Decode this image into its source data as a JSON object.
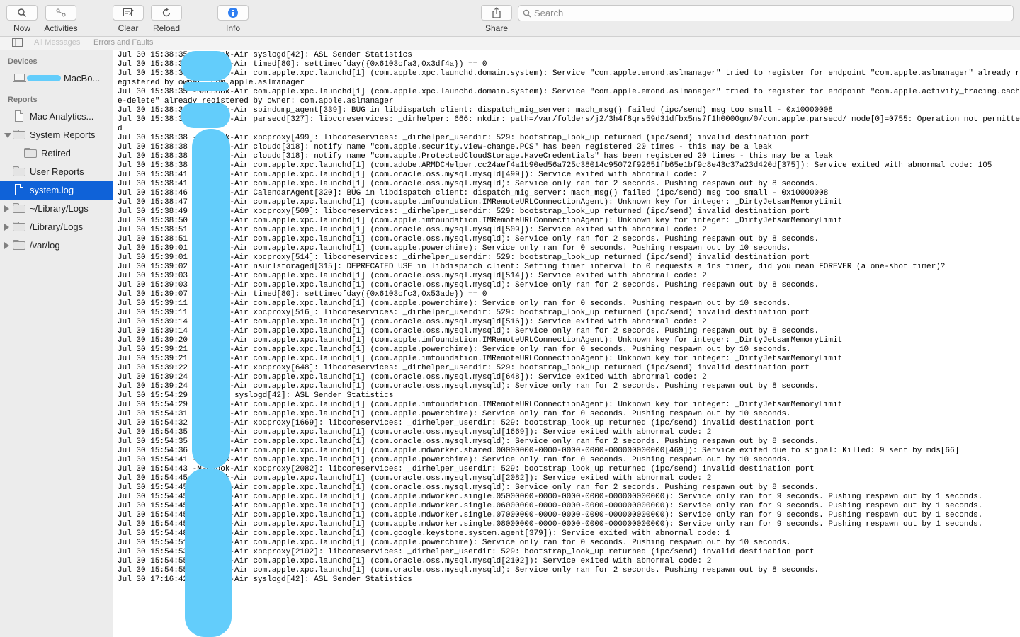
{
  "toolbar": {
    "now": "Now",
    "activities": "Activities",
    "clear": "Clear",
    "reload": "Reload",
    "info": "Info",
    "share": "Share",
    "search_placeholder": "Search"
  },
  "filters": {
    "all_messages": "All Messages",
    "errors_faults": "Errors and Faults"
  },
  "sidebar": {
    "devices_header": "Devices",
    "device_name": "MacBo...",
    "reports_header": "Reports",
    "items": [
      {
        "label": "Mac Analytics...",
        "kind": "doc"
      },
      {
        "label": "System Reports",
        "kind": "folder",
        "disclosure": "down"
      },
      {
        "label": "Retired",
        "kind": "folder"
      },
      {
        "label": "User Reports",
        "kind": "folder"
      },
      {
        "label": "system.log",
        "kind": "doc",
        "selected": true
      },
      {
        "label": "~/Library/Logs",
        "kind": "folder",
        "disclosure": "right"
      },
      {
        "label": "/Library/Logs",
        "kind": "folder",
        "disclosure": "right"
      },
      {
        "label": "/var/log",
        "kind": "folder",
        "disclosure": "right"
      }
    ]
  },
  "log_lines": [
    "Jul 30 15:38:35 -MacBook-Air syslogd[42]: ASL Sender Statistics",
    "Jul 30 15:38:35 -MacBook-Air timed[80]: settimeofday({0x6103cfa3,0x3df4a}) == 0",
    "Jul 30 15:38:35 -MacBook-Air com.apple.xpc.launchd[1] (com.apple.xpc.launchd.domain.system): Service \"com.apple.emond.aslmanager\" tried to register for endpoint \"com.apple.aslmanager\" already registered by owner: com.apple.aslmanager",
    "Jul 30 15:38:35 -MacBook-Air com.apple.xpc.launchd[1] (com.apple.xpc.launchd.domain.system): Service \"com.apple.emond.aslmanager\" tried to register for endpoint \"com.apple.activity_tracing.cache-delete\" already registered by owner: com.apple.aslmanager",
    "Jul 30 15:38:36 -MacBook-Air spindump_agent[339]: BUG in libdispatch client: dispatch_mig_server: mach_msg() failed (ipc/send) msg too small - 0x10000008",
    "Jul 30 15:38:37 -MacBook-Air parsecd[327]: libcoreservices: _dirhelper: 666: mkdir: path=/var/folders/j2/3h4f8qrs59d31dfbx5ns7f1h0000gn/0/com.apple.parsecd/ mode[0]=0755: Operation not permitted",
    "Jul 30 15:38:38 -MacBook-Air xpcproxy[499]: libcoreservices: _dirhelper_userdir: 529: bootstrap_look_up returned (ipc/send) invalid destination port",
    "Jul 30 15:38:38 -MacBook-Air cloudd[318]: notify name \"com.apple.security.view-change.PCS\" has been registered 20 times - this may be a leak",
    "Jul 30 15:38:38 -MacBook-Air cloudd[318]: notify name \"com.apple.ProtectedCloudStorage.HaveCredentials\" has been registered 20 times - this may be a leak",
    "Jul 30 15:38:38 -MacBook-Air com.apple.xpc.launchd[1] (com.adobe.ARMDCHelper.cc24aef4a1b90ed56a725c38014c95072f92651fb65e1bf9c8e43c37a23d420d[375]): Service exited with abnormal code: 105",
    "Jul 30 15:38:41 -MacBook-Air com.apple.xpc.launchd[1] (com.oracle.oss.mysql.mysqld[499]): Service exited with abnormal code: 2",
    "Jul 30 15:38:41 -MacBook-Air com.apple.xpc.launchd[1] (com.oracle.oss.mysql.mysqld): Service only ran for 2 seconds. Pushing respawn out by 8 seconds.",
    "Jul 30 15:38:46 -MacBook-Air CalendarAgent[320]: BUG in libdispatch client: dispatch_mig_server: mach_msg() failed (ipc/send) msg too small - 0x10000008",
    "Jul 30 15:38:47 -MacBook-Air com.apple.xpc.launchd[1] (com.apple.imfoundation.IMRemoteURLConnectionAgent): Unknown key for integer: _DirtyJetsamMemoryLimit",
    "Jul 30 15:38:49 -MacBook-Air xpcproxy[509]: libcoreservices: _dirhelper_userdir: 529: bootstrap_look_up returned (ipc/send) invalid destination port",
    "Jul 30 15:38:50 -MacBook-Air com.apple.xpc.launchd[1] (com.apple.imfoundation.IMRemoteURLConnectionAgent): Unknown key for integer: _DirtyJetsamMemoryLimit",
    "Jul 30 15:38:51 -MacBook-Air com.apple.xpc.launchd[1] (com.oracle.oss.mysql.mysqld[509]): Service exited with abnormal code: 2",
    "Jul 30 15:38:51 -MacBook-Air com.apple.xpc.launchd[1] (com.oracle.oss.mysql.mysqld): Service only ran for 2 seconds. Pushing respawn out by 8 seconds.",
    "Jul 30 15:39:01 -MacBook-Air com.apple.xpc.launchd[1] (com.apple.powerchime): Service only ran for 0 seconds. Pushing respawn out by 10 seconds.",
    "Jul 30 15:39:01 -MacBook-Air xpcproxy[514]: libcoreservices: _dirhelper_userdir: 529: bootstrap_look_up returned (ipc/send) invalid destination port",
    "Jul 30 15:39:02 -MacBook-Air nsurlstoraged[315]: DEPRECATED USE in libdispatch client: Setting timer interval to 0 requests a 1ns timer, did you mean FOREVER (a one-shot timer)?",
    "Jul 30 15:39:03 -MacBook-Air com.apple.xpc.launchd[1] (com.oracle.oss.mysql.mysqld[514]): Service exited with abnormal code: 2",
    "Jul 30 15:39:03 -MacBook-Air com.apple.xpc.launchd[1] (com.oracle.oss.mysql.mysqld): Service only ran for 2 seconds. Pushing respawn out by 8 seconds.",
    "Jul 30 15:39:07 -MacBook-Air timed[80]: settimeofday({0x6103cfc3,0x53ade}) == 0",
    "Jul 30 15:39:11 -MacBook-Air com.apple.xpc.launchd[1] (com.apple.powerchime): Service only ran for 0 seconds. Pushing respawn out by 10 seconds.",
    "Jul 30 15:39:11 -MacBook-Air xpcproxy[516]: libcoreservices: _dirhelper_userdir: 529: bootstrap_look_up returned (ipc/send) invalid destination port",
    "Jul 30 15:39:14 -MacBook-Air com.apple.xpc.launchd[1] (com.oracle.oss.mysql.mysqld[516]): Service exited with abnormal code: 2",
    "Jul 30 15:39:14 -MacBook-Air com.apple.xpc.launchd[1] (com.oracle.oss.mysql.mysqld): Service only ran for 2 seconds. Pushing respawn out by 8 seconds.",
    "Jul 30 15:39:20 -MacBook-Air com.apple.xpc.launchd[1] (com.apple.imfoundation.IMRemoteURLConnectionAgent): Unknown key for integer: _DirtyJetsamMemoryLimit",
    "Jul 30 15:39:21 -MacBook-Air com.apple.xpc.launchd[1] (com.apple.powerchime): Service only ran for 0 seconds. Pushing respawn out by 10 seconds.",
    "Jul 30 15:39:21 -MacBook-Air com.apple.xpc.launchd[1] (com.apple.imfoundation.IMRemoteURLConnectionAgent): Unknown key for integer: _DirtyJetsamMemoryLimit",
    "Jul 30 15:39:22 -MacBook-Air xpcproxy[648]: libcoreservices: _dirhelper_userdir: 529: bootstrap_look_up returned (ipc/send) invalid destination port",
    "Jul 30 15:39:24 -MacBook-Air com.apple.xpc.launchd[1] (com.oracle.oss.mysql.mysqld[648]): Service exited with abnormal code: 2",
    "Jul 30 15:39:24 -MacBook-Air com.apple.xpc.launchd[1] (com.oracle.oss.mysql.mysqld): Service only ran for 2 seconds. Pushing respawn out by 8 seconds.",
    "Jul 30 15:54:29 -MacBook syslogd[42]: ASL Sender Statistics",
    "Jul 30 15:54:29 -MacBook-Air com.apple.xpc.launchd[1] (com.apple.imfoundation.IMRemoteURLConnectionAgent): Unknown key for integer: _DirtyJetsamMemoryLimit",
    "Jul 30 15:54:31 -MacBook-Air com.apple.xpc.launchd[1] (com.apple.powerchime): Service only ran for 0 seconds. Pushing respawn out by 10 seconds.",
    "Jul 30 15:54:32 -MacBook-Air xpcproxy[1669]: libcoreservices: _dirhelper_userdir: 529: bootstrap_look_up returned (ipc/send) invalid destination port",
    "Jul 30 15:54:35 -MacBook-Air com.apple.xpc.launchd[1] (com.oracle.oss.mysql.mysqld[1669]): Service exited with abnormal code: 2",
    "Jul 30 15:54:35 -MacBook-Air com.apple.xpc.launchd[1] (com.oracle.oss.mysql.mysqld): Service only ran for 2 seconds. Pushing respawn out by 8 seconds.",
    "Jul 30 15:54:36 -MacBook-Air com.apple.xpc.launchd[1] (com.apple.mdworker.shared.00000000-0000-0000-0000-000000000000[469]): Service exited due to signal: Killed: 9 sent by mds[66]",
    "Jul 30 15:54:41 -MacBook-Air com.apple.xpc.launchd[1] (com.apple.powerchime): Service only ran for 0 seconds. Pushing respawn out by 10 seconds.",
    "Jul 30 15:54:43 -MacBook-Air xpcproxy[2082]: libcoreservices: _dirhelper_userdir: 529: bootstrap_look_up returned (ipc/send) invalid destination port",
    "Jul 30 15:54:45 -MacBook-Air com.apple.xpc.launchd[1] (com.oracle.oss.mysql.mysqld[2082]): Service exited with abnormal code: 2",
    "Jul 30 15:54:45 -MacBook-Air com.apple.xpc.launchd[1] (com.oracle.oss.mysql.mysqld): Service only ran for 2 seconds. Pushing respawn out by 8 seconds.",
    "Jul 30 15:54:45 -MacBook-Air com.apple.xpc.launchd[1] (com.apple.mdworker.single.05000000-0000-0000-0000-000000000000): Service only ran for 9 seconds. Pushing respawn out by 1 seconds.",
    "Jul 30 15:54:45 -MacBook-Air com.apple.xpc.launchd[1] (com.apple.mdworker.single.06000000-0000-0000-0000-000000000000): Service only ran for 9 seconds. Pushing respawn out by 1 seconds.",
    "Jul 30 15:54:45 -MacBook-Air com.apple.xpc.launchd[1] (com.apple.mdworker.single.07000000-0000-0000-0000-000000000000): Service only ran for 9 seconds. Pushing respawn out by 1 seconds.",
    "Jul 30 15:54:45 -MacBook-Air com.apple.xpc.launchd[1] (com.apple.mdworker.single.08000000-0000-0000-0000-000000000000): Service only ran for 9 seconds. Pushing respawn out by 1 seconds.",
    "Jul 30 15:54:48 -MacBook-Air com.apple.xpc.launchd[1] (com.google.keystone.system.agent[379]): Service exited with abnormal code: 1",
    "Jul 30 15:54:51 -MacBook-Air com.apple.xpc.launchd[1] (com.apple.powerchime): Service only ran for 0 seconds. Pushing respawn out by 10 seconds.",
    "Jul 30 15:54:53 -MacBook-Air xpcproxy[2102]: libcoreservices: _dirhelper_userdir: 529: bootstrap_look_up returned (ipc/send) invalid destination port",
    "Jul 30 15:54:55 -MacBook-Air com.apple.xpc.launchd[1] (com.oracle.oss.mysql.mysqld[2102]): Service exited with abnormal code: 2",
    "Jul 30 15:54:55 -MacBook-Air com.apple.xpc.launchd[1] (com.oracle.oss.mysql.mysqld): Service only ran for 2 seconds. Pushing respawn out by 8 seconds.",
    "Jul 30 17:16:42 -MacBook-Air syslogd[42]: ASL Sender Statistics"
  ],
  "colors": {
    "selection": "#0f62d8",
    "info_icon": "#2f7ff2",
    "redaction": "#63cdfb"
  }
}
